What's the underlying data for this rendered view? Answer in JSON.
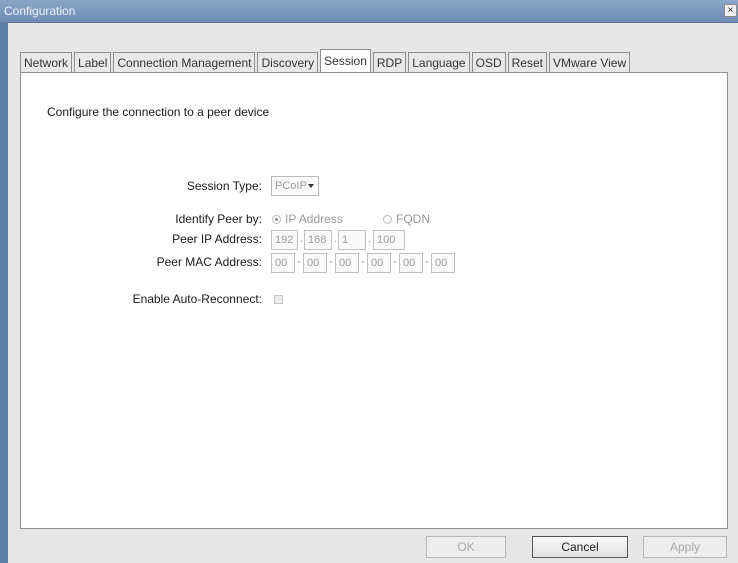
{
  "window": {
    "title": "Configuration",
    "close_glyph": "×"
  },
  "tabs": [
    {
      "label": "Network"
    },
    {
      "label": "Label"
    },
    {
      "label": "Connection Management"
    },
    {
      "label": "Discovery"
    },
    {
      "label": "Session",
      "active": true
    },
    {
      "label": "RDP"
    },
    {
      "label": "Language"
    },
    {
      "label": "OSD"
    },
    {
      "label": "Reset"
    },
    {
      "label": "VMware View"
    }
  ],
  "session": {
    "intro": "Configure the connection to a peer device",
    "session_type_label": "Session Type:",
    "session_type_value": "PCoIP",
    "identify_label": "Identify Peer by:",
    "identify_options": [
      {
        "label": "IP Address",
        "selected": true
      },
      {
        "label": "FQDN",
        "selected": false
      }
    ],
    "peer_ip_label": "Peer IP Address:",
    "peer_ip_octets": [
      "192",
      "168",
      "1",
      "100"
    ],
    "peer_mac_label": "Peer MAC Address:",
    "peer_mac_bytes": [
      "00",
      "00",
      "00",
      "00",
      "00",
      "00"
    ],
    "auto_reconnect_label": "Enable Auto-Reconnect:",
    "auto_reconnect_checked": false
  },
  "buttons": {
    "ok": "OK",
    "cancel": "Cancel",
    "apply": "Apply"
  },
  "icons": {
    "close": "close-icon",
    "dropdown": "chevron-down-icon"
  }
}
